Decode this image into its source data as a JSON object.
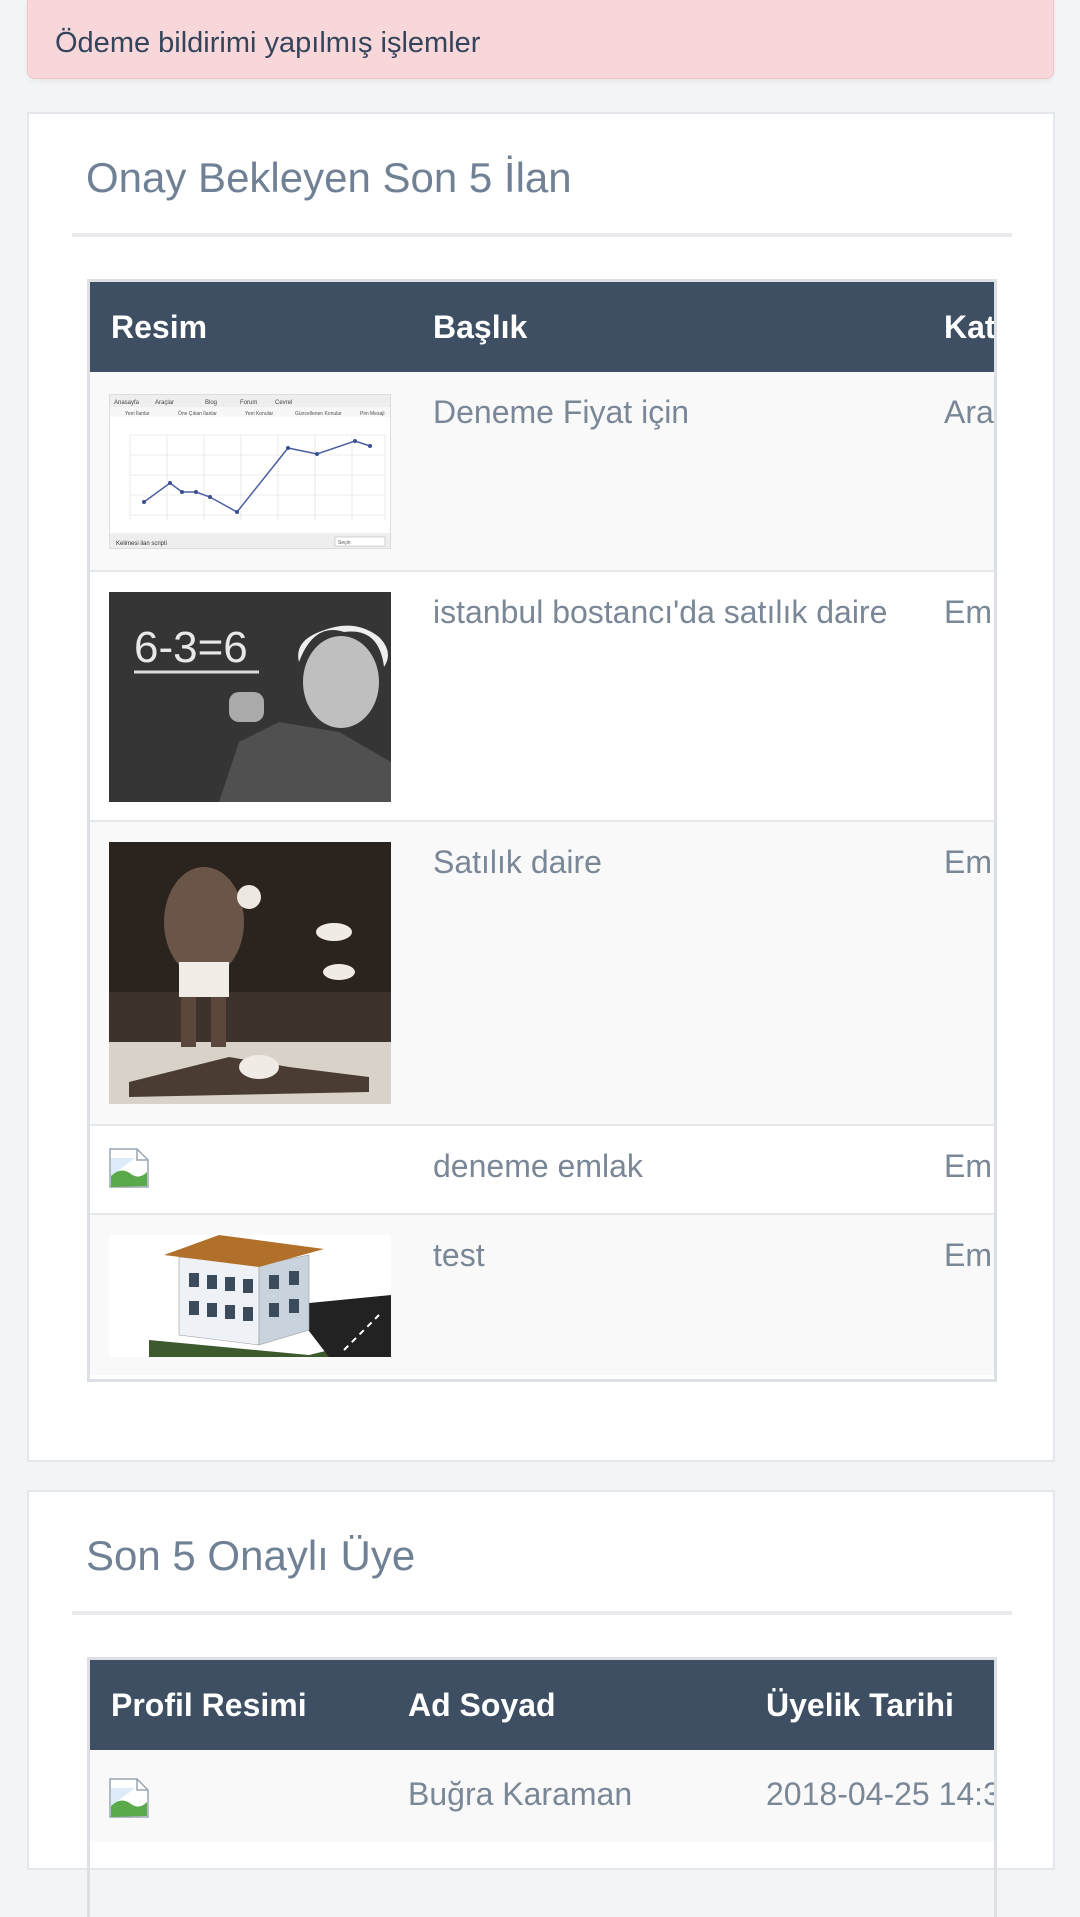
{
  "alert": {
    "text": "Ödeme bildirimi yapılmış işlemler"
  },
  "pending_listings": {
    "title": "Onay Bekleyen Son 5 İlan",
    "columns": [
      "Resim",
      "Başlık",
      "Kat"
    ],
    "rows": [
      {
        "title": "Deneme Fiyat için",
        "category": "Ara",
        "image": "chart-screenshot-thumbnail"
      },
      {
        "title": "istanbul bostancı'da satılık daire",
        "category": "Eml",
        "image": "einstein-chalkboard-photo"
      },
      {
        "title": "Satılık daire",
        "category": "Eml",
        "image": "boxing-knockout-photo"
      },
      {
        "title": "deneme emlak",
        "category": "Eml",
        "image": "broken-image-icon"
      },
      {
        "title": "test",
        "category": "Eml",
        "image": "apartment-building-render"
      }
    ],
    "thumb_chart_labels": {
      "nav": [
        "Anasayfa",
        "Araçlar",
        "Blog",
        "Forum",
        "Cevrel"
      ],
      "subnav": [
        "Yeni İlanlar",
        "Öne Çıkan İlanlar",
        "Yeni Konular",
        "Güncellenen Konular",
        "Pim Mesajl"
      ],
      "footer": "Kelimesi ilan scripti",
      "select": "Seçin"
    }
  },
  "approved_members": {
    "title": "Son 5 Onaylı Üye",
    "columns": [
      "Profil Resimi",
      "Ad Soyad",
      "Üyelik Tarihi"
    ],
    "rows": [
      {
        "name": "Buğra Karaman",
        "date": "2018-04-25 14:3"
      }
    ]
  },
  "colors": {
    "header_bg": "#3e4f63",
    "alert_bg": "#f8d7da",
    "title_text": "#708195",
    "cell_text": "#7a8797"
  }
}
